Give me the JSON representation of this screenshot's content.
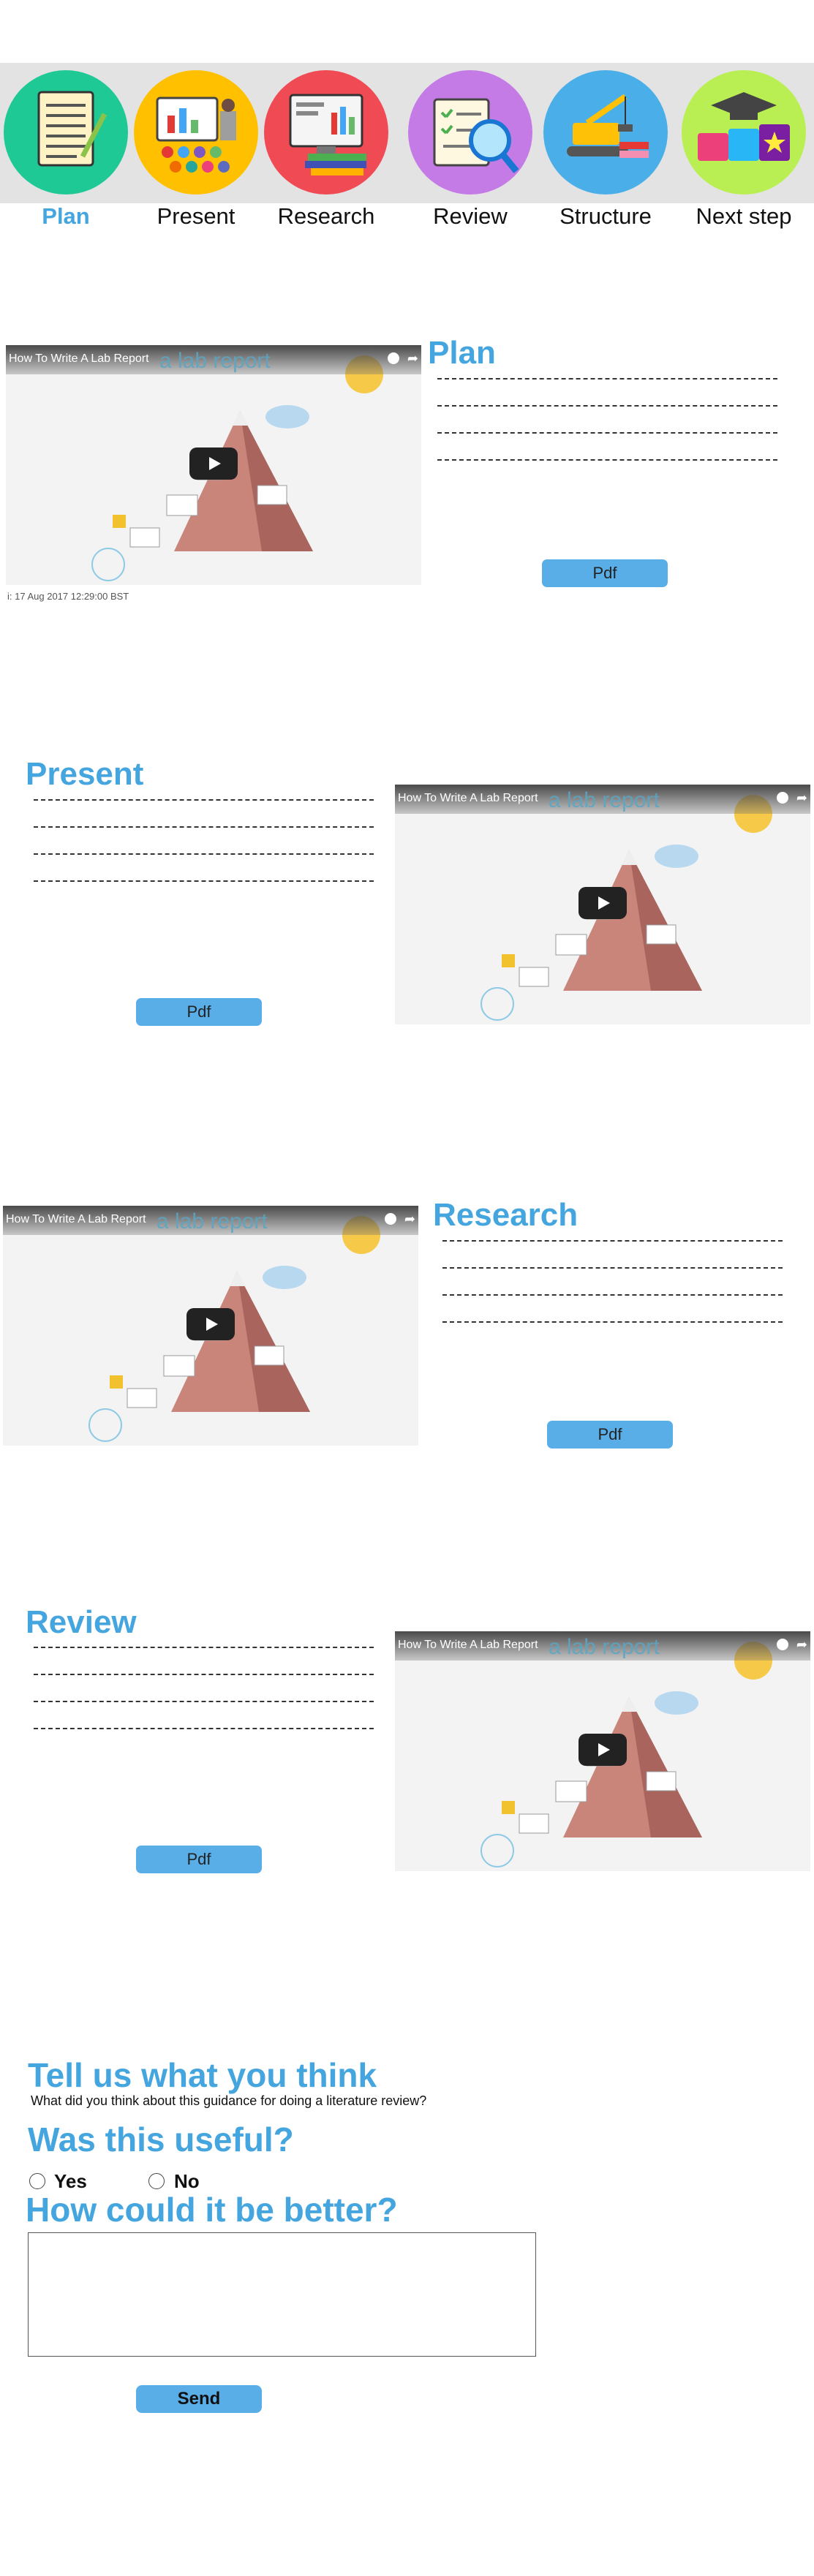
{
  "nav": {
    "items": [
      {
        "label": "Plan",
        "icon": "clipboard-icon",
        "color": "#1fc995",
        "active": true
      },
      {
        "label": "Present",
        "icon": "presentation-icon",
        "color": "#ffc000",
        "active": false
      },
      {
        "label": "Research",
        "icon": "computer-books-icon",
        "color": "#f04a54",
        "active": false
      },
      {
        "label": "Review",
        "icon": "magnifier-checklist-icon",
        "color": "#c57be6",
        "active": false
      },
      {
        "label": "Structure",
        "icon": "crane-icon",
        "color": "#4aaee8",
        "active": false
      },
      {
        "label": "Next step",
        "icon": "graduation-cap-icon",
        "color": "#b9ef52",
        "active": false
      }
    ],
    "active_color": "#45a6df"
  },
  "video": {
    "title": "How To Write A Lab Report",
    "watermark": "a lab report",
    "share_icon": "share-arrow-icon",
    "clock_icon": "clock-icon"
  },
  "sections": {
    "plan": {
      "heading": "Plan",
      "pdf_label": "Pdf",
      "date": "i: 17 Aug 2017 12:29:00 BST"
    },
    "present": {
      "heading": "Present",
      "pdf_label": "Pdf"
    },
    "research": {
      "heading": "Research",
      "pdf_label": "Pdf"
    },
    "review": {
      "heading": "Review",
      "pdf_label": "Pdf"
    }
  },
  "feedback": {
    "heading": "Tell us what you think",
    "question": "What did you think about this guidance for doing a literature review?",
    "useful_heading": "Was this useful?",
    "yes_label": "Yes",
    "no_label": "No",
    "better_heading": "How could it be better?",
    "textarea_value": "",
    "send_label": "Send"
  },
  "colors": {
    "accent": "#45a6df",
    "button": "#5aaee8",
    "nav_band": "#e3e3e3"
  }
}
